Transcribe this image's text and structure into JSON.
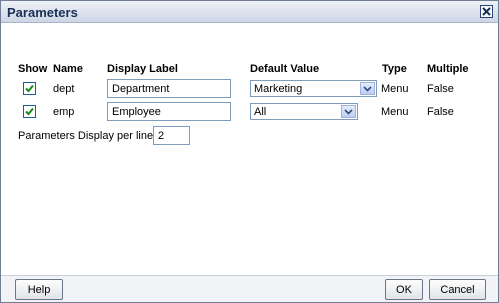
{
  "dialog": {
    "title": "Parameters",
    "close_icon": "close-icon"
  },
  "table": {
    "headers": {
      "show": "Show",
      "name": "Name",
      "display_label": "Display Label",
      "default_value": "Default Value",
      "type": "Type",
      "multiple": "Multiple"
    },
    "rows": [
      {
        "show": true,
        "name": "dept",
        "display_label": "Department",
        "default_value": "Marketing",
        "type": "Menu",
        "multiple": "False"
      },
      {
        "show": true,
        "name": "emp",
        "display_label": "Employee",
        "default_value": "All",
        "type": "Menu",
        "multiple": "False"
      }
    ]
  },
  "per_line": {
    "label": "Parameters Display per line",
    "value": "2"
  },
  "footer": {
    "help_label": "Help",
    "ok_label": "OK",
    "cancel_label": "Cancel"
  },
  "colors": {
    "title_text": "#1b2f57",
    "check_mark": "#1a8a1a",
    "border": "#7f9db9"
  }
}
